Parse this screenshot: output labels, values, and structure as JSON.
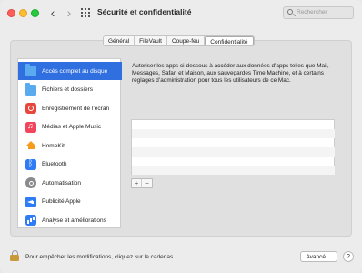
{
  "window": {
    "title": "Sécurité et confidentialité",
    "back": "‹",
    "forward": "›"
  },
  "search": {
    "placeholder": "Rechercher"
  },
  "tabs": [
    {
      "label": "Général",
      "active": false
    },
    {
      "label": "FileVault",
      "active": false
    },
    {
      "label": "Coupe-feu",
      "active": false
    },
    {
      "label": "Confidentialité",
      "active": true
    }
  ],
  "sidebar": {
    "items": [
      {
        "label": "Accès complet au disque",
        "icon": "folder-icon",
        "selected": true
      },
      {
        "label": "Fichiers et dossiers",
        "icon": "folder-icon",
        "selected": false
      },
      {
        "label": "Enregistrement de l’écran",
        "icon": "screen-recording-icon",
        "selected": false
      },
      {
        "label": "Médias et Apple Music",
        "icon": "music-icon",
        "selected": false
      },
      {
        "label": "HomeKit",
        "icon": "home-icon",
        "selected": false
      },
      {
        "label": "Bluetooth",
        "icon": "bluetooth-icon",
        "selected": false
      },
      {
        "label": "Automatisation",
        "icon": "gear-icon",
        "selected": false
      },
      {
        "label": "Publicité Apple",
        "icon": "megaphone-icon",
        "selected": false
      },
      {
        "label": "Analyse et améliorations",
        "icon": "analytics-icon",
        "selected": false
      }
    ]
  },
  "main": {
    "description": "Autoriser les apps ci-dessous à accéder aux données d’apps telles que Mail, Messages, Safari et Maison, aux sauvegardes Time Machine, et à certains réglages d’administration pour tous les utilisateurs de ce Mac.",
    "add_label": "+",
    "remove_label": "−"
  },
  "footer": {
    "lock_message": "Pour empêcher les modifications, cliquez sur le cadenas.",
    "advanced_label": "Avancé…",
    "help_label": "?"
  },
  "colors": {
    "selection": "#2f6fe0",
    "accent": "#2f7cf6"
  }
}
